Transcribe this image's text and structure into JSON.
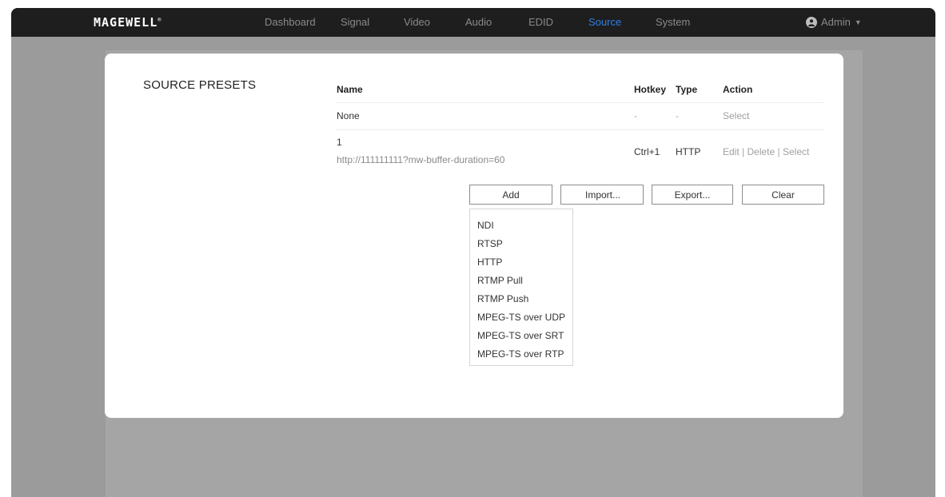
{
  "brand": {
    "logo_text": "MAGEWELL",
    "logo_mark": "®"
  },
  "nav": {
    "items": [
      {
        "label": "Dashboard"
      },
      {
        "label": "Signal"
      },
      {
        "label": "Video"
      },
      {
        "label": "Audio"
      },
      {
        "label": "EDID"
      },
      {
        "label": "Source",
        "active": true
      },
      {
        "label": "System"
      }
    ],
    "user_label": "Admin"
  },
  "colors": {
    "active_nav": "#2f7fe6",
    "topbar": "#1e1e1e",
    "backdrop": "#9b9b9b"
  },
  "section": {
    "title": "SOURCE PRESETS"
  },
  "table": {
    "headers": {
      "name": "Name",
      "hotkey": "Hotkey",
      "type": "Type",
      "action": "Action"
    },
    "rows": [
      {
        "name": "None",
        "url": "",
        "hotkey": "-",
        "type": "-",
        "actions": [
          "Select"
        ]
      },
      {
        "name": "1",
        "url": "http://111111111?mw-buffer-duration=60",
        "hotkey": "Ctrl+1",
        "type": "HTTP",
        "actions": [
          "Edit",
          "Delete",
          "Select"
        ]
      }
    ],
    "action_separator": "|"
  },
  "buttons": {
    "add": "Add",
    "import": "Import...",
    "export": "Export...",
    "clear": "Clear"
  },
  "add_menu": {
    "options": [
      "NDI",
      "RTSP",
      "HTTP",
      "RTMP Pull",
      "RTMP Push",
      "MPEG-TS over UDP",
      "MPEG-TS over SRT",
      "MPEG-TS over RTP"
    ]
  },
  "icons": {
    "user": "user-avatar-icon",
    "caret": "chevron-down-icon"
  }
}
